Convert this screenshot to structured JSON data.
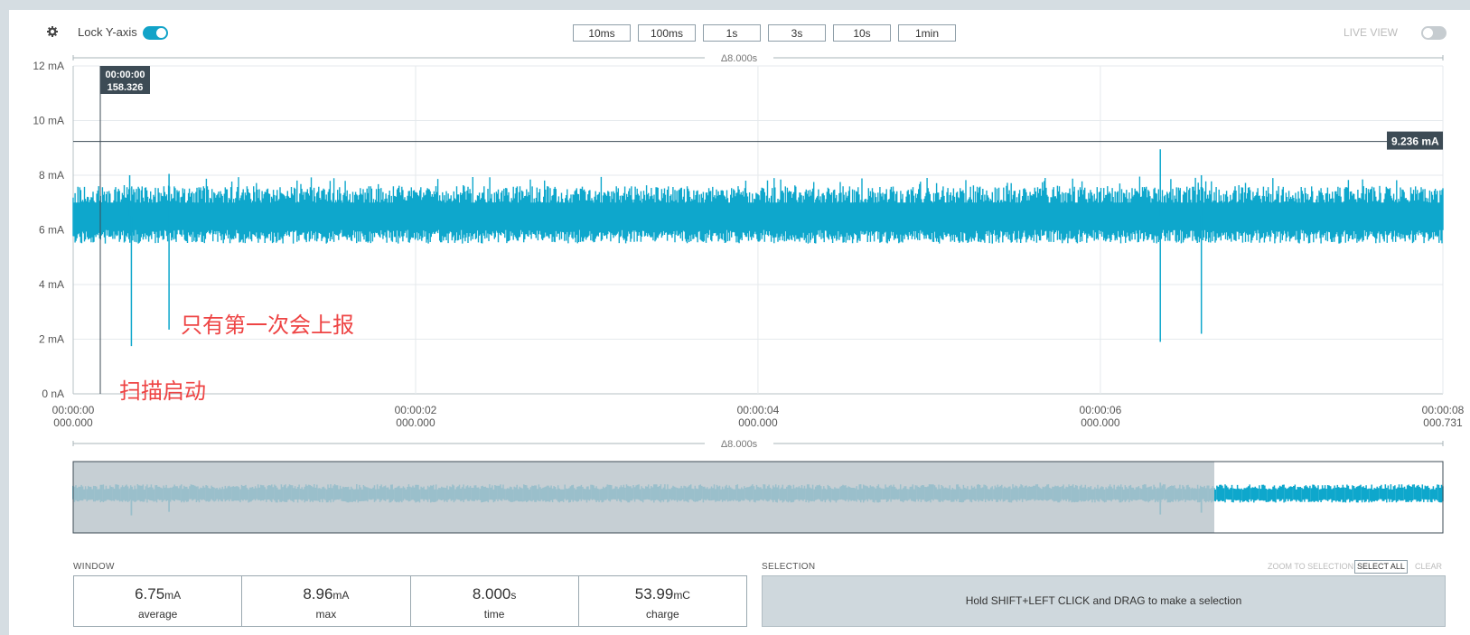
{
  "toolbar": {
    "lock_label": "Lock Y-axis",
    "zoom_buttons": [
      "10ms",
      "100ms",
      "1s",
      "3s",
      "10s",
      "1min"
    ],
    "live_view_label": "LIVE VIEW"
  },
  "colors": {
    "accent": "#12a3c8",
    "trace": "#0ea7cc",
    "overlay": "#b9c4cb",
    "annotation": "#ee4444"
  },
  "icons": [
    "gear-icon"
  ],
  "chart": {
    "delta_label": "Δ8.000s",
    "y_ticks": [
      "12 mA",
      "10 mA",
      "8 mA",
      "6 mA",
      "4 mA",
      "2 mA",
      "0 nA"
    ],
    "x_ticks": [
      {
        "line1": "00:00:00",
        "line2": "000.000"
      },
      {
        "line1": "00:00:02",
        "line2": "000.000"
      },
      {
        "line1": "00:00:04",
        "line2": "000.000"
      },
      {
        "line1": "00:00:06",
        "line2": "000.000"
      },
      {
        "line1": "00:00:08",
        "line2": "000.731"
      }
    ],
    "cursor_label_line1": "00:00:00",
    "cursor_label_line2": "158.326",
    "hline_label": "9.236 mA",
    "annotations": [
      "只有第一次会上报",
      "扫描启动"
    ]
  },
  "chart_data": {
    "type": "line",
    "title": "",
    "xlabel": "",
    "ylabel": "",
    "xlim": [
      0,
      8.000731
    ],
    "ylim": [
      0,
      12
    ],
    "y_unit": "mA",
    "grid": true,
    "cursor_x_s": 0.158326,
    "hline_y_mA": 9.236,
    "band_min_mA": 5.5,
    "band_max_mA": 7.6,
    "spikes": [
      {
        "x": 0.34,
        "y": 1.75
      },
      {
        "x": 0.33,
        "y": 8.0
      },
      {
        "x": 0.56,
        "y": 2.35
      },
      {
        "x": 0.56,
        "y": 8.05
      },
      {
        "x": 6.35,
        "y": 1.9
      },
      {
        "x": 6.35,
        "y": 8.95
      },
      {
        "x": 6.59,
        "y": 2.2
      },
      {
        "x": 6.59,
        "y": 8.0
      }
    ]
  },
  "minimap": {
    "delta_label": "Δ8.000s"
  },
  "window": {
    "label": "WINDOW",
    "stats": [
      {
        "value": "6.75",
        "unit": "mA",
        "label": "average"
      },
      {
        "value": "8.96",
        "unit": "mA",
        "label": "max"
      },
      {
        "value": "8.000",
        "unit": "s",
        "label": "time"
      },
      {
        "value": "53.99",
        "unit": "mC",
        "label": "charge"
      }
    ]
  },
  "selection": {
    "label": "SELECTION",
    "zoom_label": "ZOOM TO SELECTION",
    "select_all_label": "SELECT ALL",
    "clear_label": "CLEAR",
    "hint": "Hold SHIFT+LEFT CLICK and DRAG to make a selection"
  }
}
